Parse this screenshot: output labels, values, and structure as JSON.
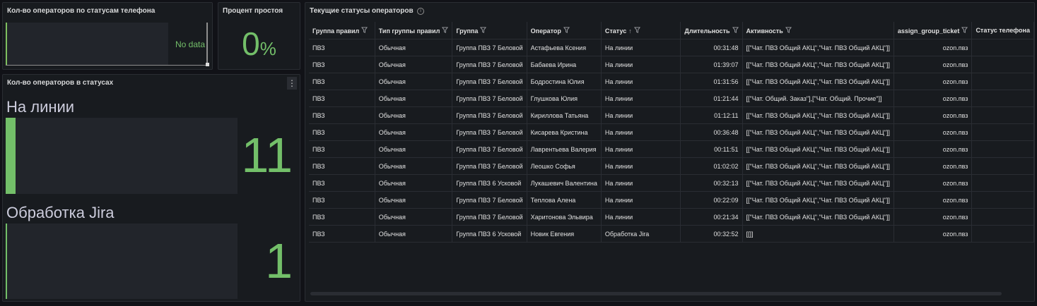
{
  "panel_phone_status": {
    "title": "Кол-во операторов по статусам телефона",
    "no_data": "No data"
  },
  "panel_idle": {
    "title": "Процент простоя",
    "value": "0",
    "unit": "%"
  },
  "panel_status_counts": {
    "title": "Кол-во операторов в статусах",
    "menu": "⋮",
    "items": [
      {
        "label": "На линии",
        "value": "11",
        "fill_fraction": 1.0
      },
      {
        "label": "Обработка Jira",
        "value": "1",
        "fill_fraction": 0.09
      }
    ]
  },
  "panel_table": {
    "title": "Текущие статусы операторов",
    "info": "i",
    "headers": [
      "Группа правил",
      "Тип группы правил",
      "Группа",
      "Оператор",
      "Статус",
      "Длительность",
      "Активность",
      "assign_group_ticket",
      "Статус телефона"
    ],
    "sort_indicator": "↑",
    "rows": [
      [
        "ПВЗ",
        "Обычная",
        "Группа ПВЗ 7 Беловой",
        "Астафьева Ксения",
        "На линии",
        "00:31:48",
        "[[\"Чат. ПВЗ Общий АКЦ\",\"Чат. ПВЗ Общий АКЦ\"]]",
        "ozon.пвз",
        ""
      ],
      [
        "ПВЗ",
        "Обычная",
        "Группа ПВЗ 7 Беловой",
        "Бабаева Ирина",
        "На линии",
        "01:39:07",
        "[[\"Чат. ПВЗ Общий АКЦ\",\"Чат. ПВЗ Общий АКЦ\"]]",
        "ozon.пвз",
        ""
      ],
      [
        "ПВЗ",
        "Обычная",
        "Группа ПВЗ 7 Беловой",
        "Бодростина Юлия",
        "На линии",
        "01:31:56",
        "[[\"Чат. ПВЗ Общий АКЦ\",\"Чат. ПВЗ Общий АКЦ\"]]",
        "ozon.пвз",
        ""
      ],
      [
        "ПВЗ",
        "Обычная",
        "Группа ПВЗ 7 Беловой",
        "Глушкова Юлия",
        "На линии",
        "01:21:44",
        "[[\"Чат. Общий. Заказ\"],[\"Чат. Общий. Прочие\"]]",
        "ozon.пвз",
        ""
      ],
      [
        "ПВЗ",
        "Обычная",
        "Группа ПВЗ 7 Беловой",
        "Кириллова Татьяна",
        "На линии",
        "01:12:11",
        "[[\"Чат. ПВЗ Общий АКЦ\",\"Чат. ПВЗ Общий АКЦ\"]]",
        "ozon.пвз",
        ""
      ],
      [
        "ПВЗ",
        "Обычная",
        "Группа ПВЗ 7 Беловой",
        "Кисарева Кристина",
        "На линии",
        "00:36:48",
        "[[\"Чат. ПВЗ Общий АКЦ\",\"Чат. ПВЗ Общий АКЦ\"]]",
        "ozon.пвз",
        ""
      ],
      [
        "ПВЗ",
        "Обычная",
        "Группа ПВЗ 7 Беловой",
        "Лаврентьева Валерия",
        "На линии",
        "00:11:51",
        "[[\"Чат. ПВЗ Общий АКЦ\",\"Чат. ПВЗ Общий АКЦ\"]]",
        "ozon.пвз",
        ""
      ],
      [
        "ПВЗ",
        "Обычная",
        "Группа ПВЗ 7 Беловой",
        "Леошко Софья",
        "На линии",
        "01:02:02",
        "[[\"Чат. ПВЗ Общий АКЦ\",\"Чат. ПВЗ Общий АКЦ\"]]",
        "ozon.пвз",
        ""
      ],
      [
        "ПВЗ",
        "Обычная",
        "Группа ПВЗ 6 Усковой",
        "Лукашевич Валентина",
        "На линии",
        "00:32:13",
        "[[\"Чат. ПВЗ Общий АКЦ\",\"Чат. ПВЗ Общий АКЦ\"]]",
        "ozon.пвз",
        ""
      ],
      [
        "ПВЗ",
        "Обычная",
        "Группа ПВЗ 7 Беловой",
        "Теплова Алена",
        "На линии",
        "00:22:09",
        "[[\"Чат. ПВЗ Общий АКЦ\",\"Чат. ПВЗ Общий АКЦ\"]]",
        "ozon.пвз",
        ""
      ],
      [
        "ПВЗ",
        "Обычная",
        "Группа ПВЗ 7 Беловой",
        "Харитонова Эльвира",
        "На линии",
        "00:21:34",
        "[[\"Чат. ПВЗ Общий АКЦ\",\"Чат. ПВЗ Общий АКЦ\"]]",
        "ozon.пвз",
        ""
      ],
      [
        "ПВЗ",
        "Обычная",
        "Группа ПВЗ 6 Усковой",
        "Новик Евгения",
        "Обработка Jira",
        "00:32:52",
        "[[]]",
        "ozon.пвз",
        ""
      ]
    ]
  },
  "colors": {
    "accent_green": "#73bf69",
    "background": "#111217",
    "panel": "#181b1f"
  }
}
